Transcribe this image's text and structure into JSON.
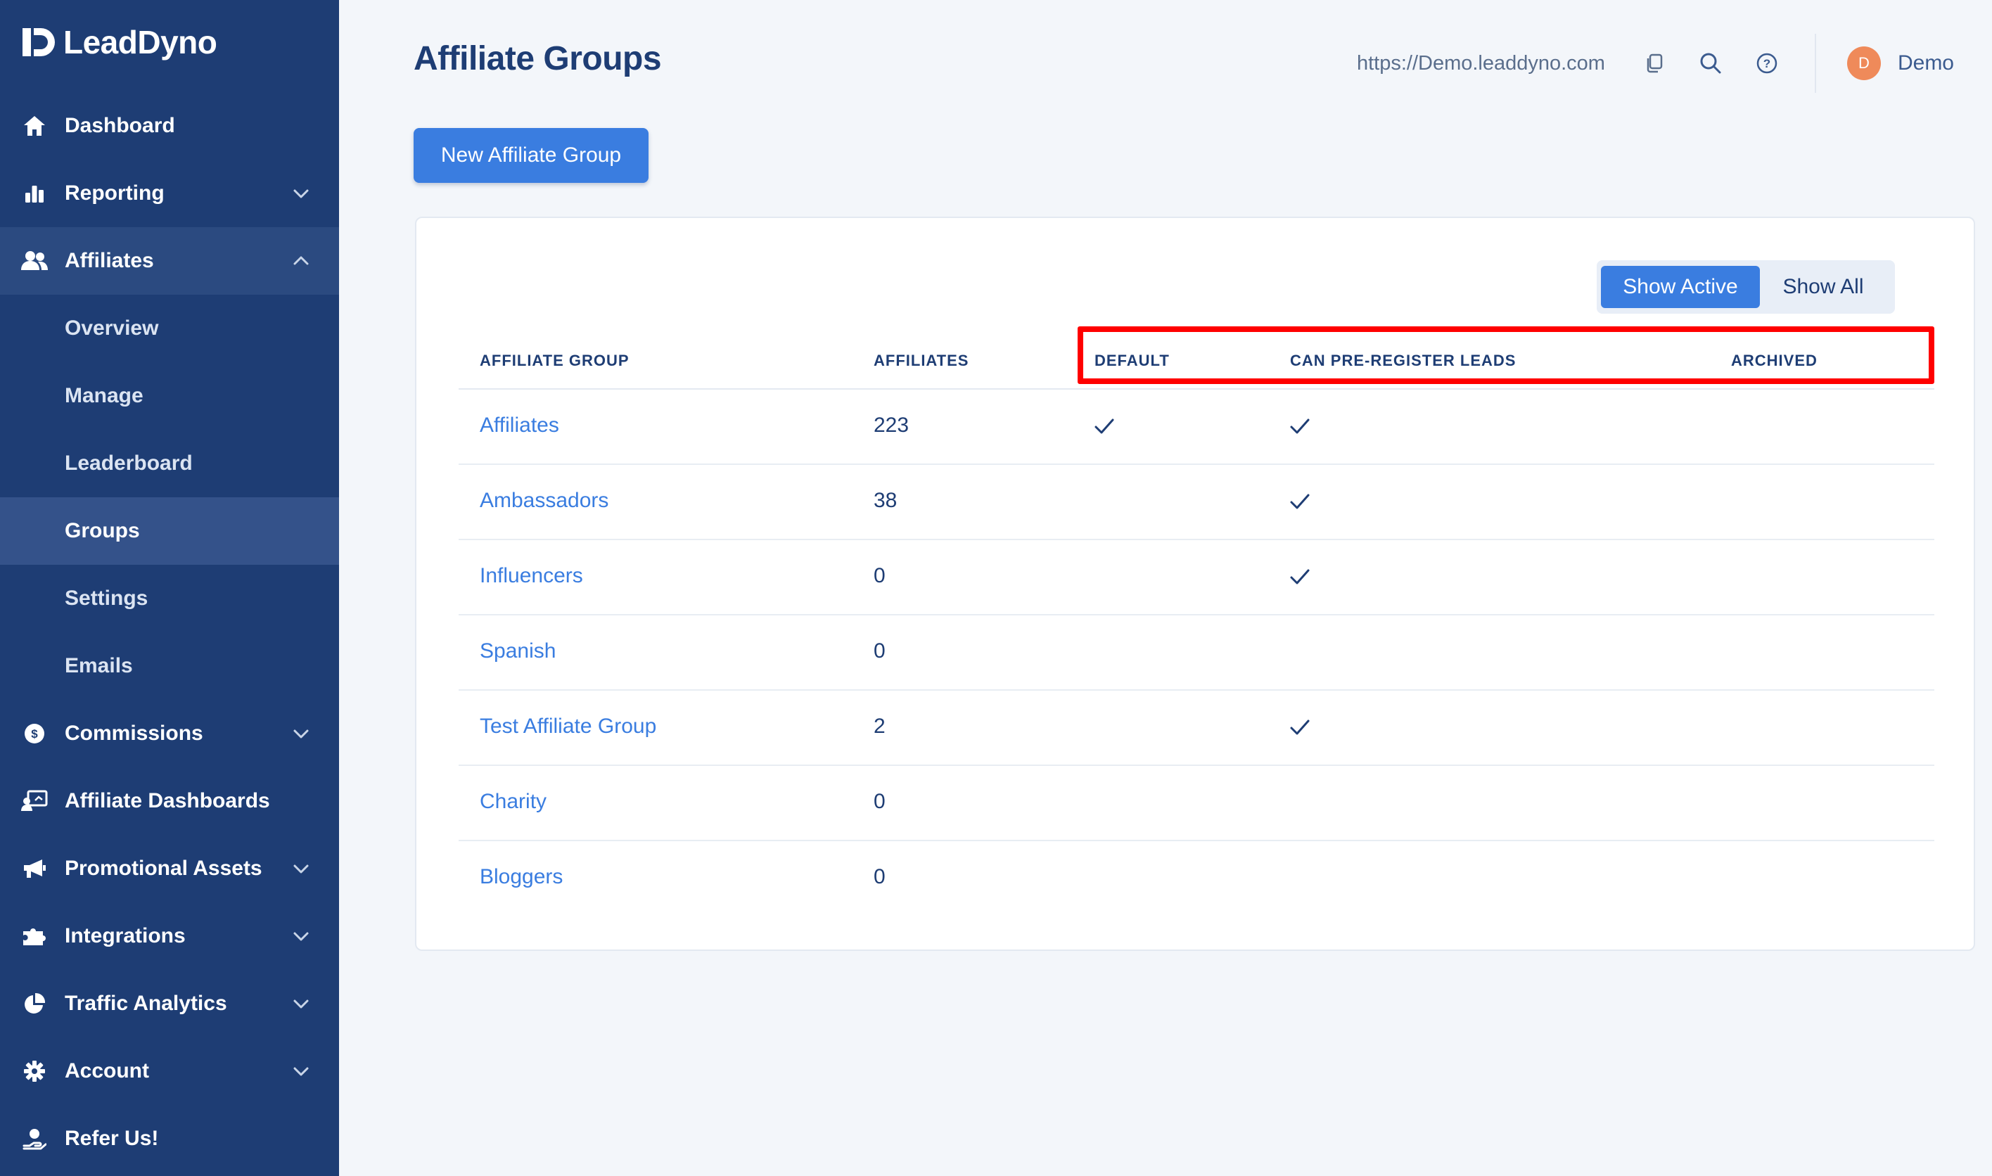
{
  "brand": {
    "name": "LeadDyno"
  },
  "sidebar": {
    "items": [
      {
        "label": "Dashboard"
      },
      {
        "label": "Reporting"
      },
      {
        "label": "Affiliates"
      },
      {
        "label": "Commissions"
      },
      {
        "label": "Affiliate Dashboards"
      },
      {
        "label": "Promotional Assets"
      },
      {
        "label": "Integrations"
      },
      {
        "label": "Traffic Analytics"
      },
      {
        "label": "Account"
      },
      {
        "label": "Refer Us!"
      }
    ],
    "affiliates_sub": [
      {
        "label": "Overview"
      },
      {
        "label": "Manage"
      },
      {
        "label": "Leaderboard"
      },
      {
        "label": "Groups",
        "active": true
      },
      {
        "label": "Settings"
      },
      {
        "label": "Emails"
      }
    ]
  },
  "header": {
    "title": "Affiliate Groups",
    "site_url": "https://Demo.leaddyno.com",
    "user_initial": "D",
    "user_name": "Demo"
  },
  "actions": {
    "new_group_label": "New Affiliate Group"
  },
  "filter": {
    "show_active": "Show Active",
    "show_all": "Show All",
    "selected": "Show Active"
  },
  "table": {
    "columns": [
      "AFFILIATE GROUP",
      "AFFILIATES",
      "DEFAULT",
      "CAN PRE-REGISTER LEADS",
      "ARCHIVED"
    ],
    "rows": [
      {
        "name": "Affiliates",
        "count": "223",
        "default": true,
        "pre_register": true,
        "archived": false
      },
      {
        "name": "Ambassadors",
        "count": "38",
        "default": false,
        "pre_register": true,
        "archived": false
      },
      {
        "name": "Influencers",
        "count": "0",
        "default": false,
        "pre_register": true,
        "archived": false
      },
      {
        "name": "Spanish",
        "count": "0",
        "default": false,
        "pre_register": false,
        "archived": false
      },
      {
        "name": "Test Affiliate Group",
        "count": "2",
        "default": false,
        "pre_register": true,
        "archived": false
      },
      {
        "name": "Charity",
        "count": "0",
        "default": false,
        "pre_register": false,
        "archived": false
      },
      {
        "name": "Bloggers",
        "count": "0",
        "default": false,
        "pre_register": false,
        "archived": false
      }
    ]
  },
  "colors": {
    "sidebar_bg": "#1e3d74",
    "accent": "#3a7de0",
    "highlight": "#ff0000"
  }
}
